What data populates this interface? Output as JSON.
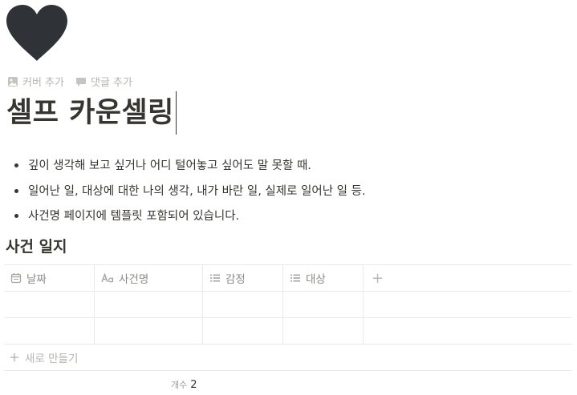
{
  "page": {
    "icon": "heart-icon",
    "add_cover_label": "커버 추가",
    "add_comment_label": "댓글 추가",
    "title": "셀프 카운셀링"
  },
  "bullets": [
    "깊이 생각해 보고 싶거나 어디 털어놓고 싶어도 말 못할 때.",
    "일어난 일, 대상에 대한 나의 생각, 내가 바란 일, 실제로 일어난 일 등.",
    "사건명 페이지에 템플릿 포함되어 있습니다."
  ],
  "database": {
    "title": "사건 일지",
    "columns": [
      {
        "label": "날짜",
        "icon": "calendar-icon"
      },
      {
        "label": "사건명",
        "icon": "text-aa-icon"
      },
      {
        "label": "감정",
        "icon": "list-icon"
      },
      {
        "label": "대상",
        "icon": "list-icon"
      }
    ],
    "add_column_label": "+",
    "rows": [
      {
        "date": "",
        "name": "",
        "emotion": "",
        "target": ""
      },
      {
        "date": "",
        "name": "",
        "emotion": "",
        "target": ""
      }
    ],
    "new_row_label": "새로 만들기",
    "count_label": "개수",
    "count_value": "2"
  },
  "colors": {
    "text": "#37352f",
    "muted": "#9b9a97",
    "border": "#e9e9e7",
    "icon_fill": "#2f3237"
  }
}
